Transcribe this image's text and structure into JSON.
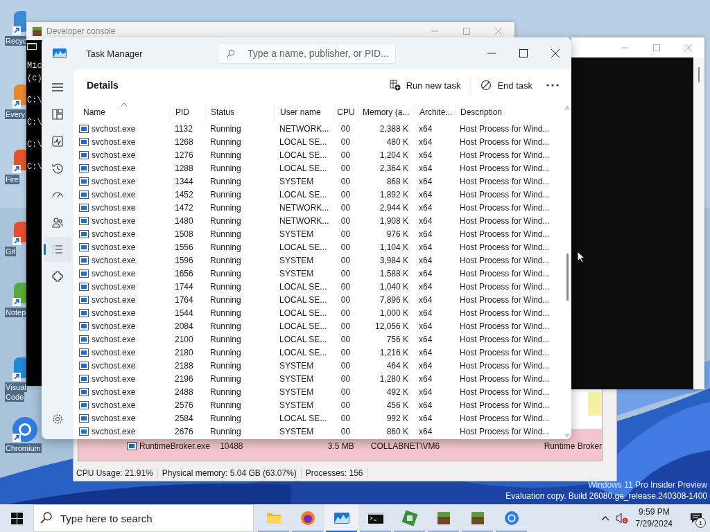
{
  "desktop_icons": [
    {
      "lines": [
        "Recyc"
      ]
    },
    {
      "lines": [
        "Every"
      ]
    },
    {
      "lines": [
        "Fire"
      ]
    },
    {
      "lines": [
        "Git"
      ]
    },
    {
      "lines": [
        "Notep"
      ]
    },
    {
      "lines": [
        "Visual",
        "Code"
      ]
    },
    {
      "lines": [
        "Chromium"
      ]
    }
  ],
  "developer_console": {
    "title": "Developer console",
    "lines": [
      "Mic",
      "(c)",
      "C:\\",
      "C:\\",
      "C:\\",
      "C:\\"
    ]
  },
  "process_window": {
    "rows": [
      {
        "name": "RuntimeBroker.exe",
        "pid": "10488",
        "memory": "3.5 MB",
        "user": "COLLABNET\\VM6",
        "description": "Runtime Broker"
      }
    ],
    "status_bar": [
      "CPU Usage: 21.91%",
      "Physical memory: 5.04 GB (63.07%)",
      "Processes: 156"
    ]
  },
  "task_manager": {
    "title": "Task Manager",
    "search": {
      "placeholder": "Type a name, publisher, or PID..."
    },
    "nav_items": [
      {
        "selected": false
      },
      {
        "selected": false
      },
      {
        "selected": false
      },
      {
        "selected": false
      },
      {
        "selected": false
      },
      {
        "selected": true
      },
      {
        "selected": false
      }
    ],
    "page_title": "Details",
    "actions": [
      "Run new task",
      "End task"
    ],
    "columns": [
      "Name",
      "PID",
      "Status",
      "User name",
      "CPU",
      "Memory (a...",
      "Archite...",
      "Description"
    ],
    "rows": [
      {
        "name": "svchost.exe",
        "pid": "1132",
        "status": "Running",
        "user": "NETWORK...",
        "cpu": "00",
        "memory": "2,388 K",
        "arch": "x64",
        "description": "Host Process for Wind..."
      },
      {
        "name": "svchost.exe",
        "pid": "1268",
        "status": "Running",
        "user": "LOCAL SE...",
        "cpu": "00",
        "memory": "480 K",
        "arch": "x64",
        "description": "Host Process for Wind..."
      },
      {
        "name": "svchost.exe",
        "pid": "1276",
        "status": "Running",
        "user": "LOCAL SE...",
        "cpu": "00",
        "memory": "1,204 K",
        "arch": "x64",
        "description": "Host Process for Wind..."
      },
      {
        "name": "svchost.exe",
        "pid": "1288",
        "status": "Running",
        "user": "LOCAL SE...",
        "cpu": "00",
        "memory": "2,364 K",
        "arch": "x64",
        "description": "Host Process for Wind..."
      },
      {
        "name": "svchost.exe",
        "pid": "1344",
        "status": "Running",
        "user": "SYSTEM",
        "cpu": "00",
        "memory": "868 K",
        "arch": "x64",
        "description": "Host Process for Wind..."
      },
      {
        "name": "svchost.exe",
        "pid": "1452",
        "status": "Running",
        "user": "LOCAL SE...",
        "cpu": "00",
        "memory": "1,892 K",
        "arch": "x64",
        "description": "Host Process for Wind..."
      },
      {
        "name": "svchost.exe",
        "pid": "1472",
        "status": "Running",
        "user": "NETWORK...",
        "cpu": "00",
        "memory": "2,944 K",
        "arch": "x64",
        "description": "Host Process for Wind..."
      },
      {
        "name": "svchost.exe",
        "pid": "1480",
        "status": "Running",
        "user": "NETWORK...",
        "cpu": "00",
        "memory": "1,908 K",
        "arch": "x64",
        "description": "Host Process for Wind..."
      },
      {
        "name": "svchost.exe",
        "pid": "1508",
        "status": "Running",
        "user": "SYSTEM",
        "cpu": "00",
        "memory": "976 K",
        "arch": "x64",
        "description": "Host Process for Wind..."
      },
      {
        "name": "svchost.exe",
        "pid": "1556",
        "status": "Running",
        "user": "LOCAL SE...",
        "cpu": "00",
        "memory": "1,104 K",
        "arch": "x64",
        "description": "Host Process for Wind..."
      },
      {
        "name": "svchost.exe",
        "pid": "1596",
        "status": "Running",
        "user": "SYSTEM",
        "cpu": "00",
        "memory": "3,984 K",
        "arch": "x64",
        "description": "Host Process for Wind..."
      },
      {
        "name": "svchost.exe",
        "pid": "1656",
        "status": "Running",
        "user": "SYSTEM",
        "cpu": "00",
        "memory": "1,588 K",
        "arch": "x64",
        "description": "Host Process for Wind..."
      },
      {
        "name": "svchost.exe",
        "pid": "1744",
        "status": "Running",
        "user": "LOCAL SE...",
        "cpu": "00",
        "memory": "1,040 K",
        "arch": "x64",
        "description": "Host Process for Wind..."
      },
      {
        "name": "svchost.exe",
        "pid": "1764",
        "status": "Running",
        "user": "LOCAL SE...",
        "cpu": "00",
        "memory": "7,896 K",
        "arch": "x64",
        "description": "Host Process for Wind..."
      },
      {
        "name": "svchost.exe",
        "pid": "1544",
        "status": "Running",
        "user": "LOCAL SE...",
        "cpu": "00",
        "memory": "1,000 K",
        "arch": "x64",
        "description": "Host Process for Wind..."
      },
      {
        "name": "svchost.exe",
        "pid": "2084",
        "status": "Running",
        "user": "LOCAL SE...",
        "cpu": "00",
        "memory": "12,056 K",
        "arch": "x64",
        "description": "Host Process for Wind..."
      },
      {
        "name": "svchost.exe",
        "pid": "2100",
        "status": "Running",
        "user": "LOCAL SE...",
        "cpu": "00",
        "memory": "756 K",
        "arch": "x64",
        "description": "Host Process for Wind..."
      },
      {
        "name": "svchost.exe",
        "pid": "2180",
        "status": "Running",
        "user": "LOCAL SE...",
        "cpu": "00",
        "memory": "1,216 K",
        "arch": "x64",
        "description": "Host Process for Wind..."
      },
      {
        "name": "svchost.exe",
        "pid": "2188",
        "status": "Running",
        "user": "SYSTEM",
        "cpu": "00",
        "memory": "464 K",
        "arch": "x64",
        "description": "Host Process for Wind..."
      },
      {
        "name": "svchost.exe",
        "pid": "2196",
        "status": "Running",
        "user": "SYSTEM",
        "cpu": "00",
        "memory": "1,280 K",
        "arch": "x64",
        "description": "Host Process for Wind..."
      },
      {
        "name": "svchost.exe",
        "pid": "2488",
        "status": "Running",
        "user": "SYSTEM",
        "cpu": "00",
        "memory": "492 K",
        "arch": "x64",
        "description": "Host Process for Wind..."
      },
      {
        "name": "svchost.exe",
        "pid": "2576",
        "status": "Running",
        "user": "SYSTEM",
        "cpu": "00",
        "memory": "456 K",
        "arch": "x64",
        "description": "Host Process for Wind..."
      },
      {
        "name": "svchost.exe",
        "pid": "2584",
        "status": "Running",
        "user": "LOCAL SE...",
        "cpu": "00",
        "memory": "992 K",
        "arch": "x64",
        "description": "Host Process for Wind..."
      },
      {
        "name": "svchost.exe",
        "pid": "2676",
        "status": "Running",
        "user": "SYSTEM",
        "cpu": "00",
        "memory": "860 K",
        "arch": "x64",
        "description": "Host Process for Wind..."
      }
    ]
  },
  "watermark_lines": [
    "Windows 11 Pro Insider Preview",
    "Evaluation copy. Build 26080.ge_release.240308-1400"
  ],
  "taskbar": {
    "search": {
      "placeholder": "Type here to search"
    },
    "apps": [
      {
        "selected": false
      },
      {
        "selected": false
      },
      {
        "selected": true
      },
      {
        "selected": false
      },
      {
        "selected": false
      },
      {
        "selected": false
      },
      {
        "selected": false
      },
      {
        "selected": false
      }
    ],
    "time": "9:59 PM",
    "date": "7/29/2024",
    "notification_count": "1"
  }
}
